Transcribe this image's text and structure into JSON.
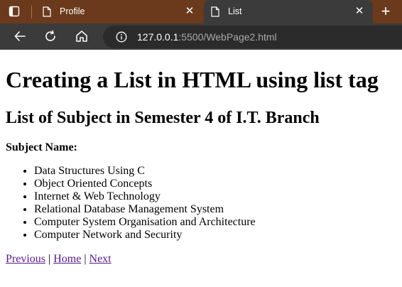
{
  "browser": {
    "tabs": [
      {
        "title": "Profile",
        "active": false
      },
      {
        "title": "List",
        "active": true
      }
    ],
    "tab_close_glyph": "✕",
    "new_tab_glyph": "+",
    "url_host": "127.0.0.1",
    "url_rest": ":5500/WebPage2.html",
    "icons": {
      "window": "window-icon",
      "tab_doc": "document-icon",
      "back": "back-arrow-icon",
      "reload": "reload-icon",
      "home": "home-icon",
      "info": "info-icon"
    },
    "colors": {
      "tabstrip": "#6b3a1c",
      "toolbar": "#3b3b3b",
      "addressbar": "#2b2b2b"
    }
  },
  "page": {
    "heading": "Creating a List in HTML using list tag",
    "subheading": "List of Subject in Semester 4 of I.T. Branch",
    "subject_label": "Subject Name:",
    "subjects": [
      "Data Structures Using C",
      "Object Oriented Concepts",
      "Internet & Web Technology",
      "Relational Database Management System",
      "Computer System Organisation and Architecture",
      "Computer Network and Security"
    ],
    "nav": {
      "previous": "Previous",
      "home": "Home",
      "next": "Next",
      "separator": "|"
    },
    "link_color": "#551a8b"
  }
}
